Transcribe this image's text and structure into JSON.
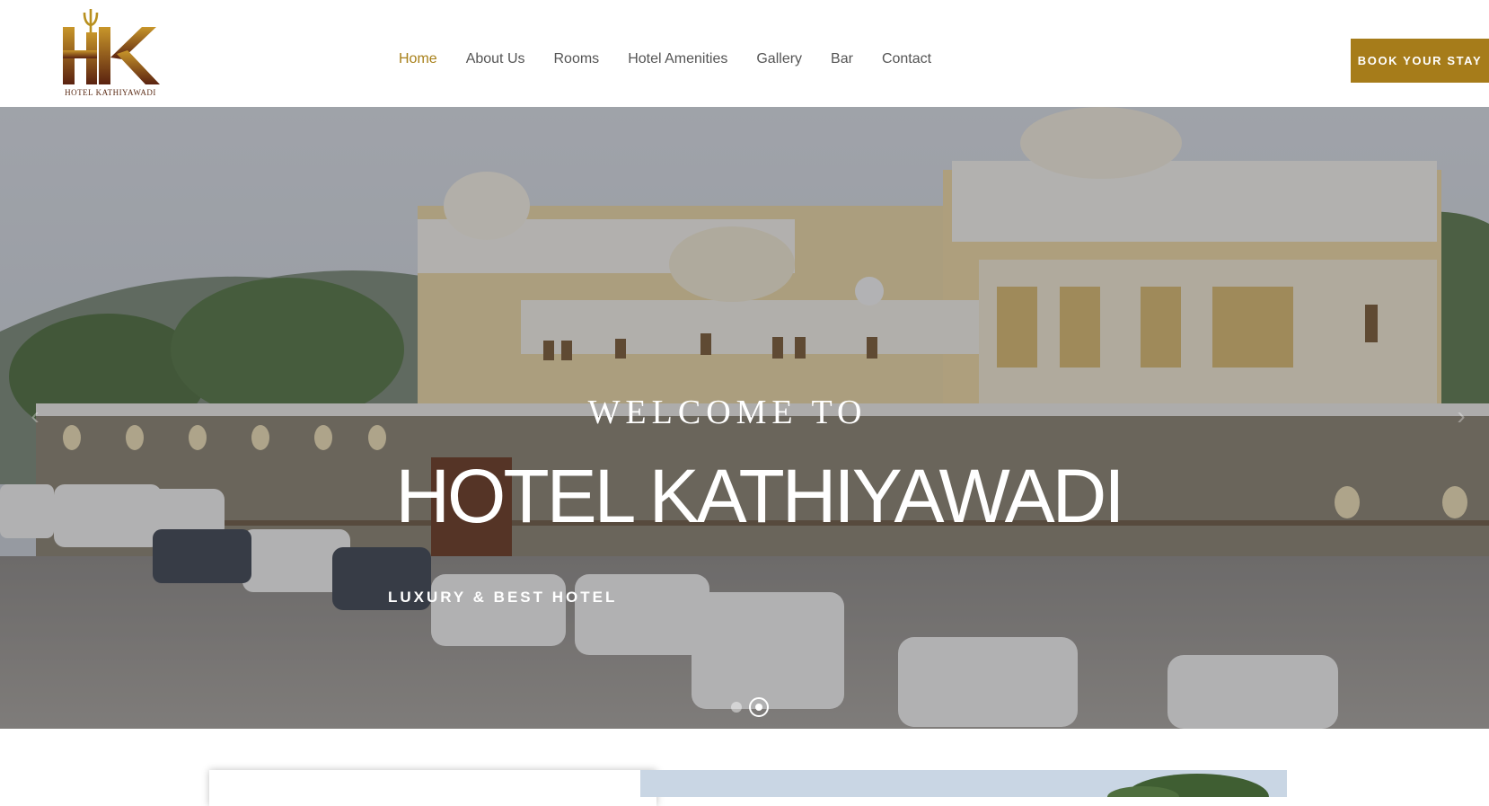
{
  "brand": {
    "monogram": "HK",
    "name": "HOTEL KATHIYAWADI",
    "colors": {
      "gold": "#a67c1a",
      "brown": "#5a2a14",
      "active_nav": "#a8801a"
    }
  },
  "nav": {
    "items": [
      {
        "label": "Home",
        "active": true
      },
      {
        "label": "About Us",
        "active": false
      },
      {
        "label": "Rooms",
        "active": false
      },
      {
        "label": "Hotel Amenities",
        "active": false
      },
      {
        "label": "Gallery",
        "active": false
      },
      {
        "label": "Bar",
        "active": false
      },
      {
        "label": "Contact",
        "active": false
      }
    ]
  },
  "cta": {
    "label": "BOOK YOUR STAY"
  },
  "hero": {
    "welcome": "WELCOME TO",
    "title": "HOTEL KATHIYAWADI",
    "subtitle": "LUXURY & BEST HOTEL",
    "prev_icon": "chevron-left-icon",
    "next_icon": "chevron-right-icon",
    "slide_count": 2,
    "active_slide": 2
  }
}
